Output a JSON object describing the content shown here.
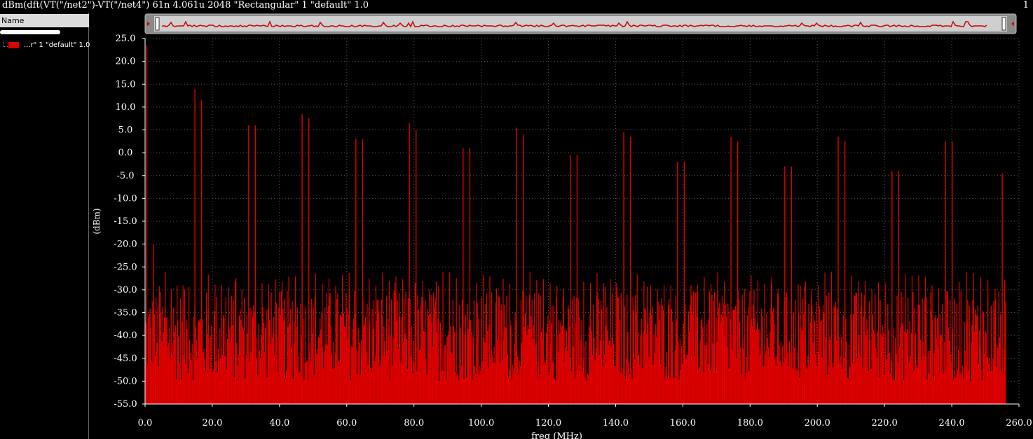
{
  "window": {
    "title": "dBm(dft(VT(\"/net2\")-VT(\"/net4\") 61n 4.061u 2048 \"Rectangular\" 1 \"default\" 1.0",
    "subwindow_number": "1"
  },
  "legend": {
    "header": "Name",
    "items": [
      {
        "label": "...r\" 1 \"default\" 1.0",
        "color": "#dd0000"
      }
    ]
  },
  "chart_data": {
    "type": "bar",
    "xlabel": "freq (MHz)",
    "ylabel": "(dBm)",
    "xlim": [
      0,
      256
    ],
    "ylim": [
      -55,
      25
    ],
    "x_ticks": [
      0,
      20,
      40,
      60,
      80,
      100,
      120,
      140,
      160,
      180,
      200,
      220,
      240,
      260
    ],
    "x_tick_labels": [
      "0.0",
      "20.0",
      "40.0",
      "60.0",
      "80.0",
      "100.0",
      "120.0",
      "140.0",
      "160.0",
      "180.0",
      "200.0",
      "220.0",
      "240.0",
      "260.0"
    ],
    "y_ticks": [
      -55,
      -50,
      -45,
      -40,
      -35,
      -30,
      -25,
      -20,
      -15,
      -10,
      -5,
      0,
      5,
      10,
      15,
      20,
      25
    ],
    "y_tick_labels": [
      "-55.0",
      "-50.0",
      "-45.0",
      "-40.0",
      "-35.0",
      "-30.0",
      "-25.0",
      "-20.0",
      "-15.0",
      "-10.0",
      "-5.0",
      "0.0",
      "5.0",
      "10.0",
      "15.0",
      "20.0",
      "25.0"
    ],
    "grid": true,
    "background_color": "#000000",
    "series_color": "#dd0000",
    "noise_floor_dBm": [
      -50,
      -30
    ],
    "peaks": [
      [
        0.5,
        23.5
      ],
      [
        2.5,
        -20
      ],
      [
        14.8,
        14
      ],
      [
        16.8,
        11.5
      ],
      [
        30.8,
        6
      ],
      [
        32.8,
        6
      ],
      [
        46.7,
        8.5
      ],
      [
        48.7,
        7.5
      ],
      [
        62.7,
        3
      ],
      [
        64.7,
        3
      ],
      [
        78.6,
        6.5
      ],
      [
        80.6,
        5
      ],
      [
        94.6,
        1
      ],
      [
        96.6,
        1
      ],
      [
        110.5,
        5.5
      ],
      [
        112.5,
        4
      ],
      [
        126.5,
        -0.5
      ],
      [
        128.5,
        -0.5
      ],
      [
        142.4,
        4.5
      ],
      [
        144.4,
        3.5
      ],
      [
        158.4,
        -2
      ],
      [
        160.4,
        -2
      ],
      [
        174.3,
        3.5
      ],
      [
        176.3,
        2.5
      ],
      [
        190.3,
        -3
      ],
      [
        192.3,
        -3
      ],
      [
        206.2,
        3.5
      ],
      [
        208.2,
        2.5
      ],
      [
        222.2,
        -4
      ],
      [
        224.2,
        -4
      ],
      [
        238.1,
        2.5
      ],
      [
        240.1,
        2.5
      ],
      [
        255.0,
        -4.5
      ]
    ],
    "secondary_peaks_dBm": -26,
    "bin_count": 1024
  },
  "overview": {
    "trace_color": "#cc0000",
    "frame_color": "#bbbbbb"
  }
}
